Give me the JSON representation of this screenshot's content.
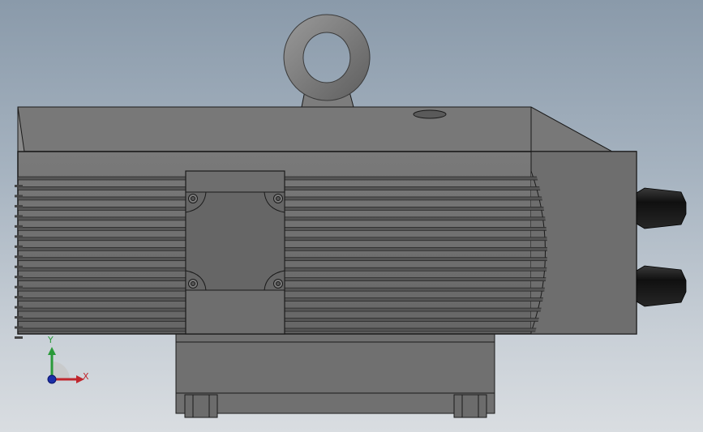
{
  "viewport": {
    "background_top": "#8a9aaa",
    "background_bottom": "#d9dde1"
  },
  "model": {
    "body_color": "#6f6f6f",
    "body_dark": "#5b5b5b",
    "body_light": "#8a8a8a",
    "outline_color": "#1a1a1a",
    "connector_color": "#1c1c1c"
  },
  "triad": {
    "x_label": "X",
    "y_label": "Y",
    "x_color": "#c0262d",
    "y_color": "#2a9a3a",
    "z_color": "#1c2fa8"
  }
}
